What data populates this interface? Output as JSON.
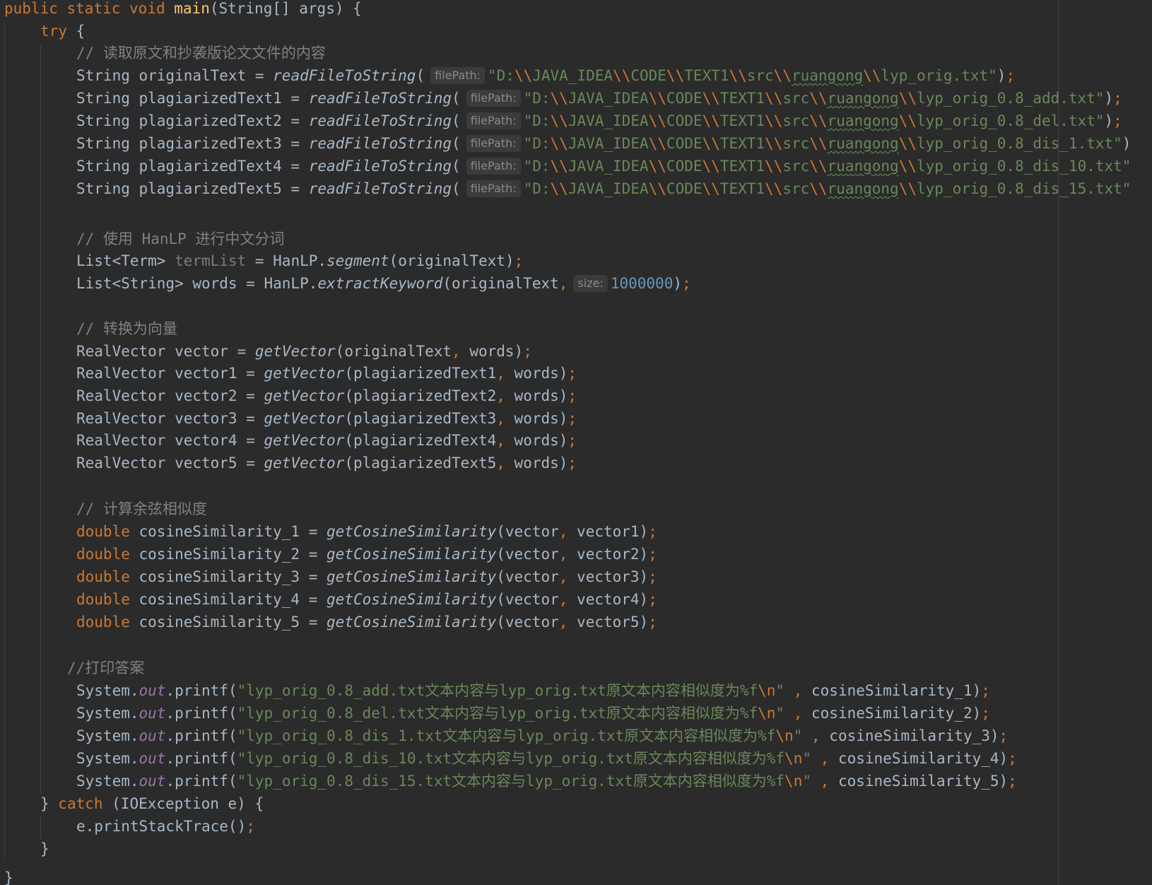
{
  "editor": {
    "lines": {
      "l0": {
        "kw1": "public",
        "kw2": "static",
        "kw3": "void",
        "name": "main",
        "rest": "(String[] args) {"
      },
      "l1": {
        "kw": "try",
        "rest": " {"
      },
      "l2": {
        "comment": "// 读取原文和抄袭版论文文件的内容"
      },
      "l3": {
        "decl": "String originalText = ",
        "fn": "readFileToString",
        "open": "(",
        "hint": "filePath:",
        "s1": "\"D:",
        "s2": "JAVA_IDEA",
        "s3": "CODE",
        "s4": "TEXT1",
        "s5": "src",
        "s6": "ruangong",
        "s7": "lyp_orig.txt\"",
        "close": ")",
        "semi": ";"
      },
      "l4": {
        "decl": "String plagiarizedText1 = ",
        "fn": "readFileToString",
        "open": "(",
        "hint": "filePath:",
        "s1": "\"D:",
        "s2": "JAVA_IDEA",
        "s3": "CODE",
        "s4": "TEXT1",
        "s5": "src",
        "s6": "ruangong",
        "s7": "lyp_orig_0.8_add.txt\"",
        "close": ")",
        "semi": ";"
      },
      "l5": {
        "decl": "String plagiarizedText2 = ",
        "fn": "readFileToString",
        "open": "(",
        "hint": "filePath:",
        "s1": "\"D:",
        "s2": "JAVA_IDEA",
        "s3": "CODE",
        "s4": "TEXT1",
        "s5": "src",
        "s6": "ruangong",
        "s7": "lyp_orig_0.8_del.txt\"",
        "close": ")",
        "semi": ";"
      },
      "l6": {
        "decl": "String plagiarizedText3 = ",
        "fn": "readFileToString",
        "open": "(",
        "hint": "filePath:",
        "s1": "\"D:",
        "s2": "JAVA_IDEA",
        "s3": "CODE",
        "s4": "TEXT1",
        "s5": "src",
        "s6": "ruangong",
        "s7": "lyp_orig_0.8_dis_1.txt\"",
        "close": ")"
      },
      "l7": {
        "decl": "String plagiarizedText4 = ",
        "fn": "readFileToString",
        "open": "(",
        "hint": "filePath:",
        "s1": "\"D:",
        "s2": "JAVA_IDEA",
        "s3": "CODE",
        "s4": "TEXT1",
        "s5": "src",
        "s6": "ruangong",
        "s7": "lyp_orig_0.8_dis_10.txt\""
      },
      "l8": {
        "decl": "String plagiarizedText5 = ",
        "fn": "readFileToString",
        "open": "(",
        "hint": "filePath:",
        "s1": "\"D:",
        "s2": "JAVA_IDEA",
        "s3": "CODE",
        "s4": "TEXT1",
        "s5": "src",
        "s6": "ruangong",
        "s7": "lyp_orig_0.8_dis_15.txt\""
      },
      "l10": {
        "comment": "// 使用 HanLP 进行中文分词"
      },
      "l11": {
        "type": "List<Term> ",
        "var": "termList",
        "mid": " = HanLP.",
        "fn": "segment",
        "args": "(originalText)",
        "semi": ";"
      },
      "l12": {
        "type": "List<String> words = HanLP.",
        "fn": "extractKeyword",
        "args": "(originalText",
        "comma": ",",
        "hint": "size:",
        "num": "1000000",
        "close": ")",
        "semi": ";"
      },
      "l14": {
        "comment": "// 转换为向量"
      },
      "l15": {
        "decl": "RealVector vector = ",
        "fn": "getVector",
        "a1": "(originalText",
        "comma": ",",
        "a2": " words)",
        "semi": ";"
      },
      "l16": {
        "decl": "RealVector vector1 = ",
        "fn": "getVector",
        "a1": "(plagiarizedText1",
        "comma": ",",
        "a2": " words)",
        "semi": ";"
      },
      "l17": {
        "decl": "RealVector vector2 = ",
        "fn": "getVector",
        "a1": "(plagiarizedText2",
        "comma": ",",
        "a2": " words)",
        "semi": ";"
      },
      "l18": {
        "decl": "RealVector vector3 = ",
        "fn": "getVector",
        "a1": "(plagiarizedText3",
        "comma": ",",
        "a2": " words)",
        "semi": ";"
      },
      "l19": {
        "decl": "RealVector vector4 = ",
        "fn": "getVector",
        "a1": "(plagiarizedText4",
        "comma": ",",
        "a2": " words)",
        "semi": ";"
      },
      "l20": {
        "decl": "RealVector vector5 = ",
        "fn": "getVector",
        "a1": "(plagiarizedText5",
        "comma": ",",
        "a2": " words)",
        "semi": ";"
      },
      "l22": {
        "comment": "// 计算余弦相似度"
      },
      "l23": {
        "kw": "double",
        "decl": " cosineSimilarity_1 = ",
        "fn": "getCosineSimilarity",
        "a1": "(vector",
        "comma": ",",
        "a2": " vector1)",
        "semi": ";"
      },
      "l24": {
        "kw": "double",
        "decl": " cosineSimilarity_2 = ",
        "fn": "getCosineSimilarity",
        "a1": "(vector",
        "comma": ",",
        "a2": " vector2)",
        "semi": ";"
      },
      "l25": {
        "kw": "double",
        "decl": " cosineSimilarity_3 = ",
        "fn": "getCosineSimilarity",
        "a1": "(vector",
        "comma": ",",
        "a2": " vector3)",
        "semi": ";"
      },
      "l26": {
        "kw": "double",
        "decl": " cosineSimilarity_4 = ",
        "fn": "getCosineSimilarity",
        "a1": "(vector",
        "comma": ",",
        "a2": " vector4)",
        "semi": ";"
      },
      "l27": {
        "kw": "double",
        "decl": " cosineSimilarity_5 = ",
        "fn": "getCosineSimilarity",
        "a1": "(vector",
        "comma": ",",
        "a2": " vector5)",
        "semi": ";"
      },
      "l29": {
        "comment": "//打印答案"
      },
      "l30": {
        "pre": "System.",
        "field": "out",
        "mid": ".printf(",
        "str": "\"lyp_orig_0.8_add.txt文本内容与lyp_orig.txt原文本内容相似度为%f",
        "esc": "\\n",
        "strend": "\"",
        "comma": " ,",
        "arg": " cosineSimilarity_1)",
        "semi": ";"
      },
      "l31": {
        "pre": "System.",
        "field": "out",
        "mid": ".printf(",
        "str": "\"lyp_orig_0.8_del.txt文本内容与lyp_orig.txt原文本内容相似度为%f",
        "esc": "\\n",
        "strend": "\"",
        "comma": " ,",
        "arg": " cosineSimilarity_2)",
        "semi": ";"
      },
      "l32": {
        "pre": "System.",
        "field": "out",
        "mid": ".printf(",
        "str": "\"lyp_orig_0.8_dis_1.txt文本内容与lyp_orig.txt原文本内容相似度为%f",
        "esc": "\\n",
        "strend": "\"",
        "comma": " ,",
        "arg": " cosineSimilarity_3)",
        "semi": ";"
      },
      "l33": {
        "pre": "System.",
        "field": "out",
        "mid": ".printf(",
        "str": "\"lyp_orig_0.8_dis_10.txt文本内容与lyp_orig.txt原文本内容相似度为%f",
        "esc": "\\n",
        "strend": "\"",
        "comma": " ,",
        "arg": " cosineSimilarity_4)",
        "semi": ";"
      },
      "l34": {
        "pre": "System.",
        "field": "out",
        "mid": ".printf(",
        "str": "\"lyp_orig_0.8_dis_15.txt文本内容与lyp_orig.txt原文本内容相似度为%f",
        "esc": "\\n",
        "strend": "\"",
        "comma": " ,",
        "arg": " cosineSimilarity_5)",
        "semi": ";"
      },
      "l35": {
        "pre": "} ",
        "kw": "catch",
        "rest": " (IOException e) {"
      },
      "l36": {
        "text": "e.printStackTrace()",
        "semi": ";"
      },
      "l37": {
        "text": "}"
      },
      "l38": {
        "text": "}"
      }
    },
    "escape_sequence": "\\\\"
  }
}
